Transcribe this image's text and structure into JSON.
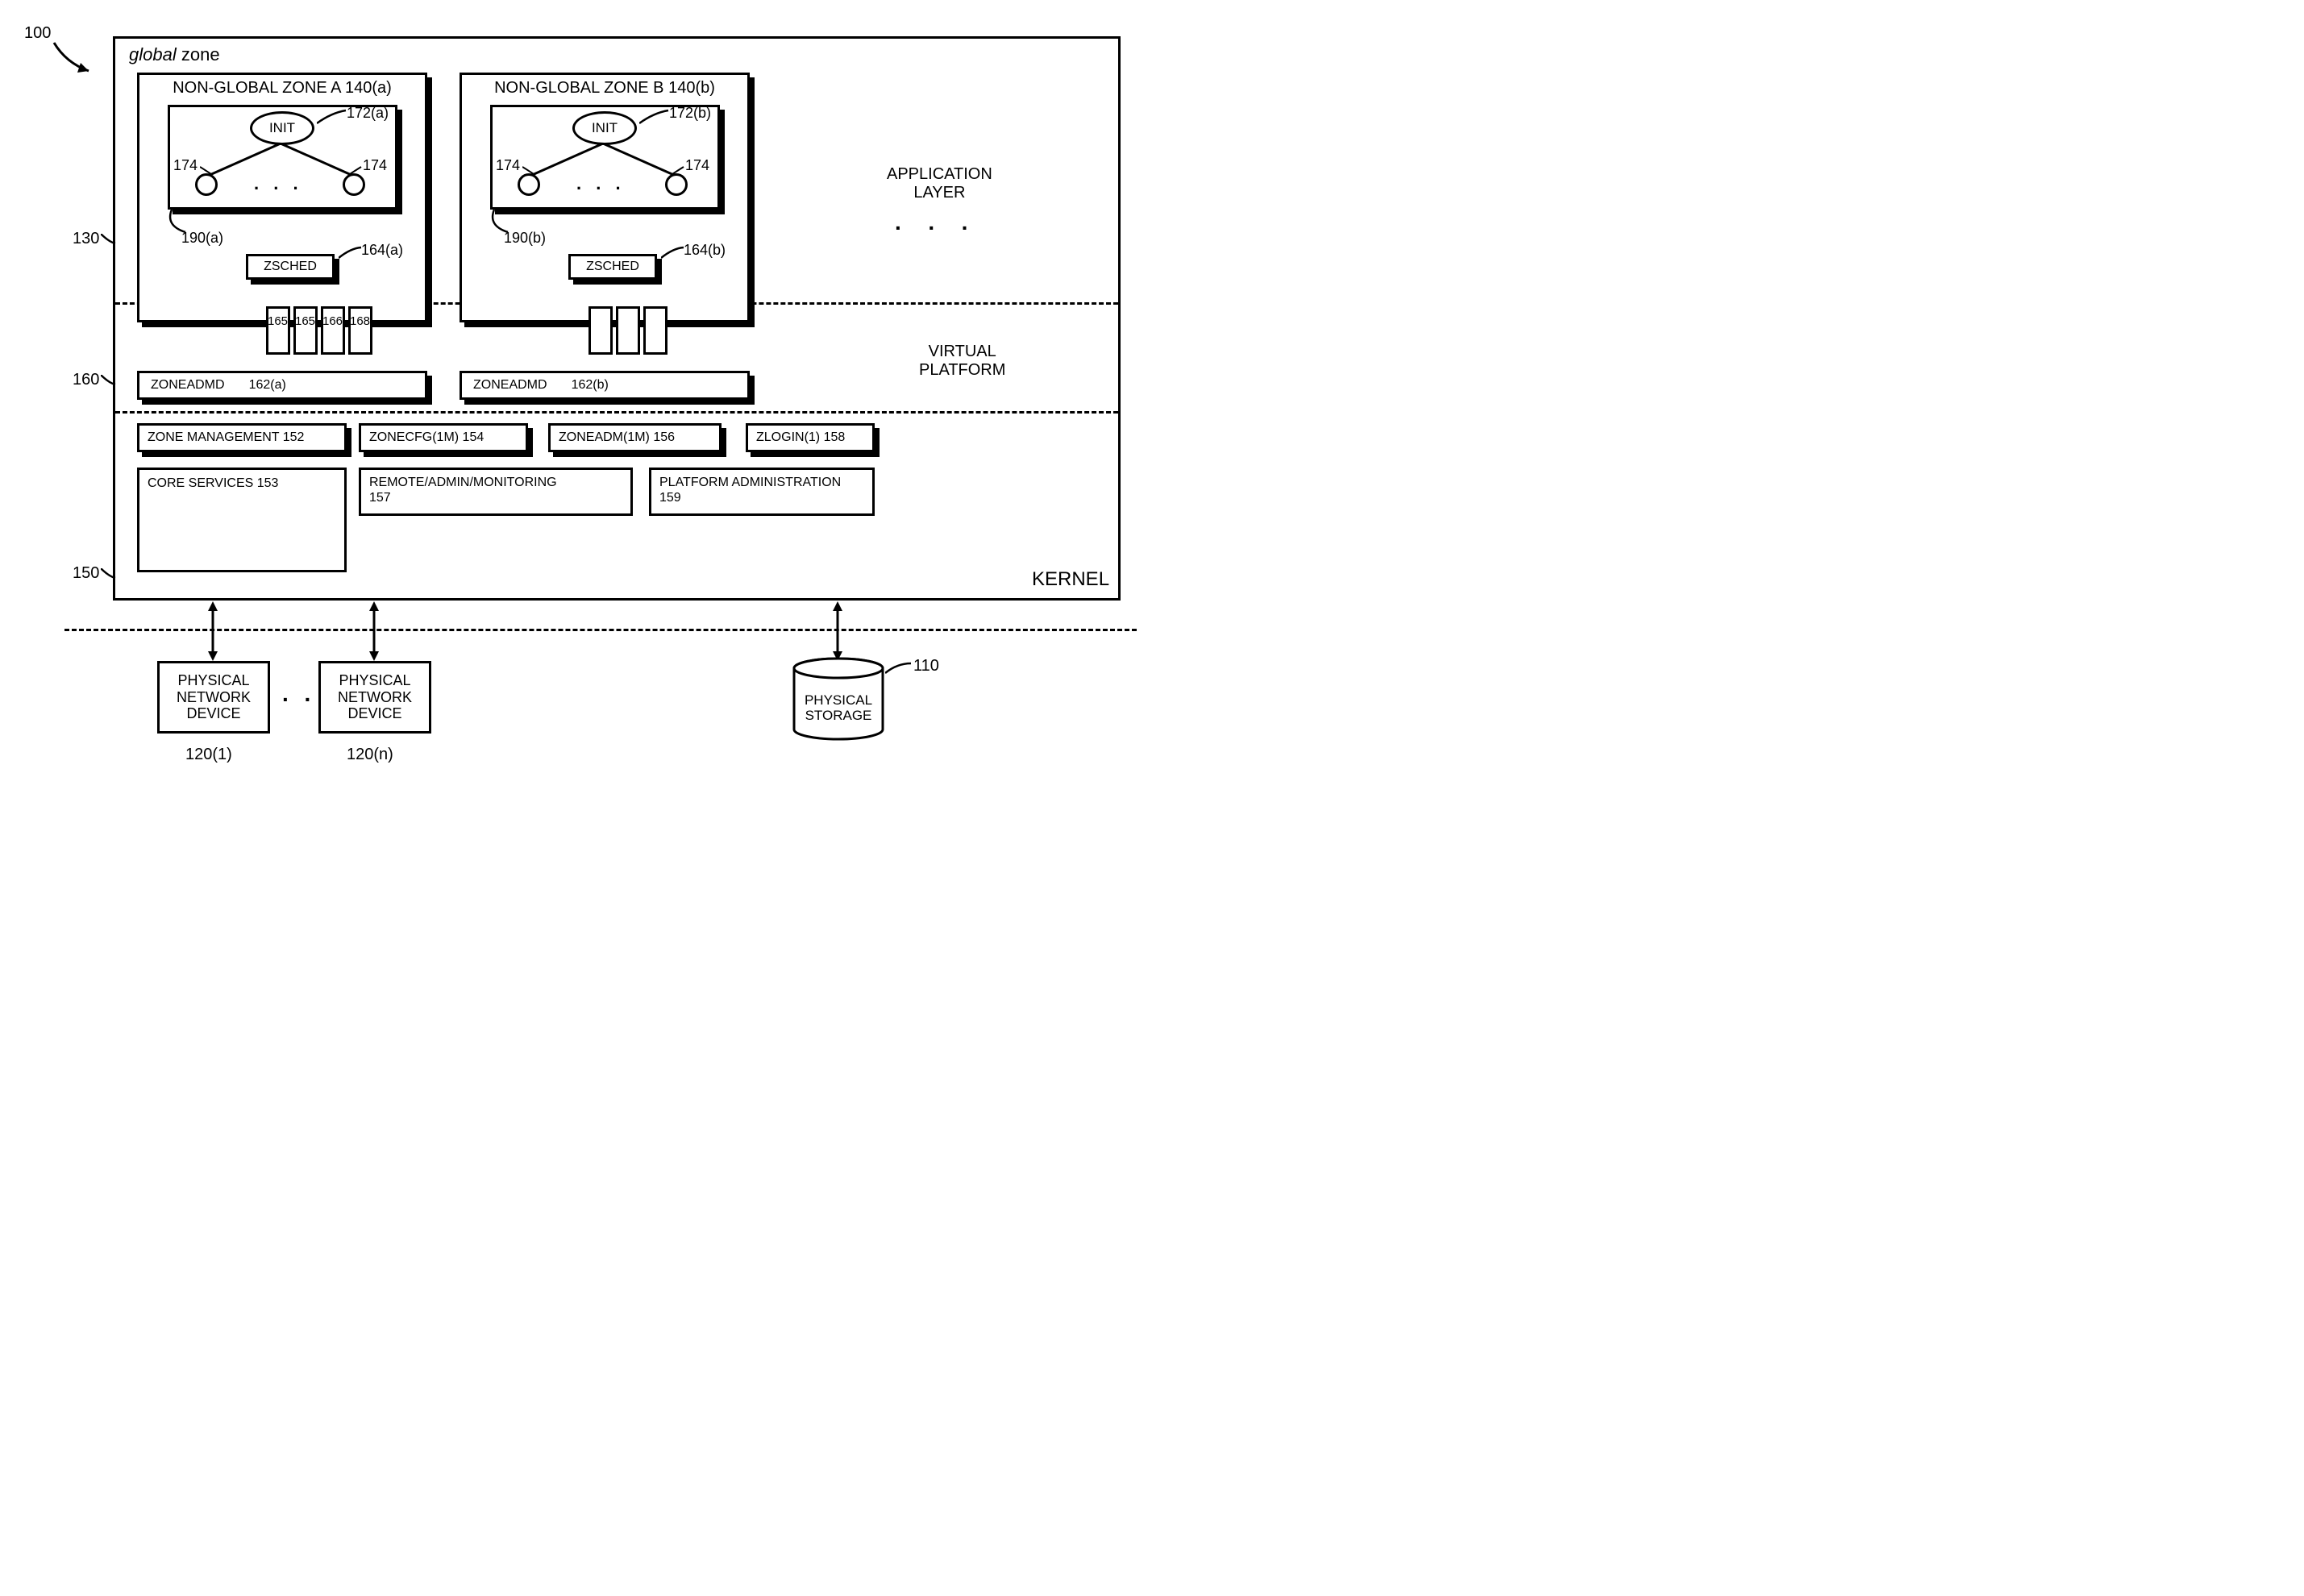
{
  "system_ref": "100",
  "global_zone_label_italic": "global",
  "global_zone_label_rest": "zone",
  "zones": {
    "a": {
      "title": "NON-GLOBAL ZONE A 140(a)",
      "init": "INIT",
      "init_ref": "172(a)",
      "proc_ref": "174",
      "proc_ref2": "174",
      "tree_ref": "190(a)",
      "zsched": "ZSCHED",
      "zsched_ref": "164(a)",
      "little_boxes": [
        "165",
        "165",
        "166",
        "168"
      ],
      "zoneadmd": "ZONEADMD",
      "zoneadmd_ref": "162(a)"
    },
    "b": {
      "title": "NON-GLOBAL ZONE B 140(b)",
      "init": "INIT",
      "init_ref": "172(b)",
      "proc_ref": "174",
      "proc_ref2": "174",
      "tree_ref": "190(b)",
      "zsched": "ZSCHED",
      "zsched_ref": "164(b)",
      "zoneadmd": "ZONEADMD",
      "zoneadmd_ref": "162(b)"
    }
  },
  "layer_labels": {
    "app": "APPLICATION\nLAYER",
    "virt": "VIRTUAL\nPLATFORM",
    "kernel": "KERNEL"
  },
  "layer_refs": {
    "app": "130",
    "virt": "160",
    "kernel": "150"
  },
  "mgmt_row": {
    "zone_mgmt": "ZONE MANAGEMENT 152",
    "zonecfg": "ZONECFG(1M)  154",
    "zoneadm": "ZONEADM(1M)  156",
    "zlogin": "ZLOGIN(1) 158"
  },
  "svc_row": {
    "core": "CORE SERVICES 153",
    "remote": "REMOTE/ADMIN/MONITORING\n157",
    "platadmin": "PLATFORM ADMINISTRATION\n159"
  },
  "devices": {
    "net": "PHYSICAL\nNETWORK\nDEVICE",
    "net_ref1": "120(1)",
    "net_ref_n": "120(n)",
    "storage": "PHYSICAL\nSTORAGE",
    "storage_ref": "110"
  }
}
